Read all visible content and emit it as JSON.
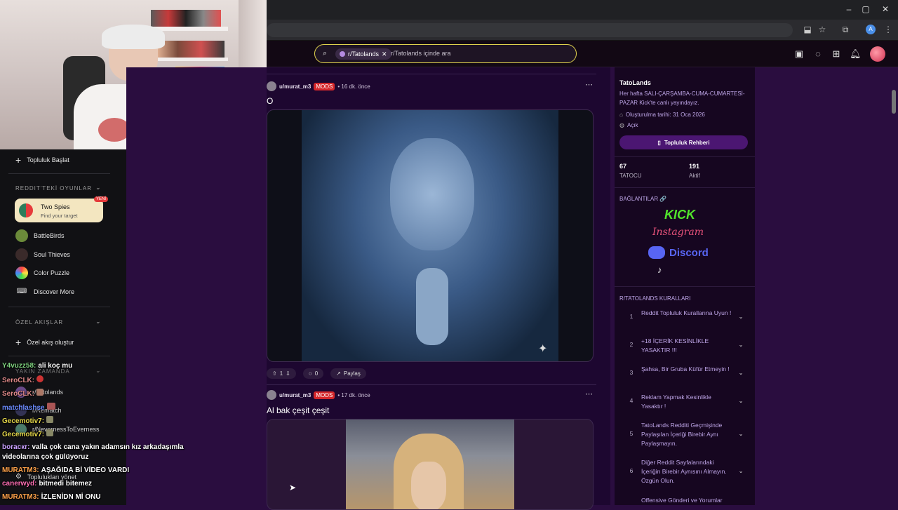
{
  "browser": {
    "window_controls": [
      "–",
      "▢",
      "✕"
    ],
    "toolbar_icons": [
      "install-icon",
      "star-icon",
      "extensions-icon",
      "profile-icon",
      "menu-icon"
    ],
    "profile_letter": "A"
  },
  "reddit_header": {
    "search_chip": "r/Tatolands",
    "search_placeholder": "r/Tatolands içinde ara",
    "icons": [
      "ads-icon",
      "chat-icon",
      "create-icon",
      "bell-icon",
      "avatar"
    ]
  },
  "sidebar": {
    "start_community": "Topluluk Başlat",
    "games_header": "REDDIT'TEKİ OYUNLAR",
    "featured_game": {
      "name": "Two Spies",
      "subtitle": "Find your target",
      "badge": "YENİ"
    },
    "games": [
      "BattleBirds",
      "Soul Thieves",
      "Color Puzzle"
    ],
    "discover_more": "Discover More",
    "custom_feeds_header": "ÖZEL AKIŞLAR",
    "create_custom_feed": "Özel akış oluştur",
    "recent_header": "YAKIN ZAMANDA",
    "recent": [
      "r/Tatolands",
      "r/Rematch",
      "r/NevernessToEverness"
    ],
    "manage_communities": "Toplulukları yönet"
  },
  "chat": [
    {
      "user": "Y4vuzz58:",
      "msg": "ali koç mu",
      "color": "#7fd27f"
    },
    {
      "user": "SeroCLK:",
      "msg": "",
      "color": "#e08a8a"
    },
    {
      "user": "SeroCLK:",
      "msg": "",
      "color": "#e08a8a"
    },
    {
      "user": "matchlashse",
      "msg": "",
      "color": "#6c8cff"
    },
    {
      "user": "Gecemotiv7:",
      "msg": "",
      "color": "#e6d84a"
    },
    {
      "user": "Gecemotiv7:",
      "msg": "",
      "color": "#e6d84a"
    },
    {
      "user": "boracкr:",
      "msg": "valla çok cana yakın adamsın kız arkadaşımla",
      "color": "#c9a0ff"
    },
    {
      "user": "",
      "msg": "videolarına çok gülüyoruz",
      "color": "#ffffff"
    },
    {
      "user": "MURATM3:",
      "msg": "AŞAĞIDA Bİ VİDEO VARDI",
      "color": "#ffa24a"
    },
    {
      "user": "canerwyd:",
      "msg": "bitmedi bitemez",
      "color": "#ff6fb4"
    },
    {
      "user": "MURATM3:",
      "msg": "İZLENİDN Mİ ONU",
      "color": "#ffa24a"
    }
  ],
  "feed": {
    "posts": [
      {
        "author": "u/murat_m3",
        "flair": "MODS",
        "time": "• 16 dk. önce",
        "title": "O",
        "votes": "1",
        "comments": "0",
        "share": "Paylaş"
      },
      {
        "author": "u/murat_m3",
        "flair": "MODS",
        "time": "• 17 dk. önce",
        "title": "Al bak çeşit çeşit"
      }
    ]
  },
  "community": {
    "name": "TatoLands",
    "description": "Her hafta SALI-ÇARŞAMBA-CUMA-CUMARTESİ-PAZAR Kick'te canlı yayındayız.",
    "created": "Oluşturulma tarihi: 31 Oca 2026",
    "visibility": "Açık",
    "guide_button": "Topluluk Rehberi",
    "members_count": "67",
    "members_label": "TATOCU",
    "active_count": "191",
    "active_label": "Aktif",
    "links_header": "BAĞLANTILAR 🔗",
    "links": [
      "KICK",
      "Instagram",
      "Discord",
      "TikTok"
    ],
    "rules_header": "R/TATOLANDS KURALLARI",
    "rules": [
      {
        "n": "1",
        "text": "Reddit Topluluk Kurallarına Uyun !"
      },
      {
        "n": "2",
        "text": "+18 İÇERİK KESİNLİKLE YASAKTIR !!!"
      },
      {
        "n": "3",
        "text": "Şahsa, Bir Gruba Küfür Etmeyin !"
      },
      {
        "n": "4",
        "text": "Reklam Yapmak Kesinlikle Yasaktır !"
      },
      {
        "n": "5",
        "text": "TatoLands Redditi Geçmişinde Paylaşılan İçeriği Birebir Aynı Paylaşmayın."
      },
      {
        "n": "6",
        "text": "Diğer Reddit Sayfalarındaki İçeriğin Birebir Aynısını Almayın. Özgün Olun."
      },
      {
        "n": "",
        "text": "Offensive Gönderi ve Yorumlar"
      }
    ]
  }
}
